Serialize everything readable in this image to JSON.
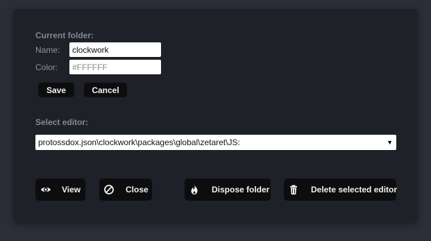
{
  "current_folder": {
    "heading": "Current folder:",
    "name_label": "Name:",
    "name_value": "clockwork",
    "color_label": "Color:",
    "color_placeholder": "#FFFFFF",
    "save_label": "Save",
    "cancel_label": "Cancel"
  },
  "editor": {
    "heading": "Select editor:",
    "selected_value": "protossdox.json\\clockwork\\packages\\global\\zetaret\\JS:",
    "arrow_glyph": "▼"
  },
  "actions": {
    "view_label": "View",
    "close_label": "Close",
    "dispose_label": "Dispose folder",
    "delete_label": "Delete selected editor"
  },
  "colors": {
    "page_background": "#2b2e36",
    "panel_background": "#1f2129",
    "button_background": "#0d0d0f",
    "label_text": "#858891",
    "button_text": "#f2f2f2"
  },
  "icons": {
    "view": "eye-icon",
    "close": "ban-icon",
    "dispose": "fire-icon",
    "delete": "trash-icon"
  }
}
